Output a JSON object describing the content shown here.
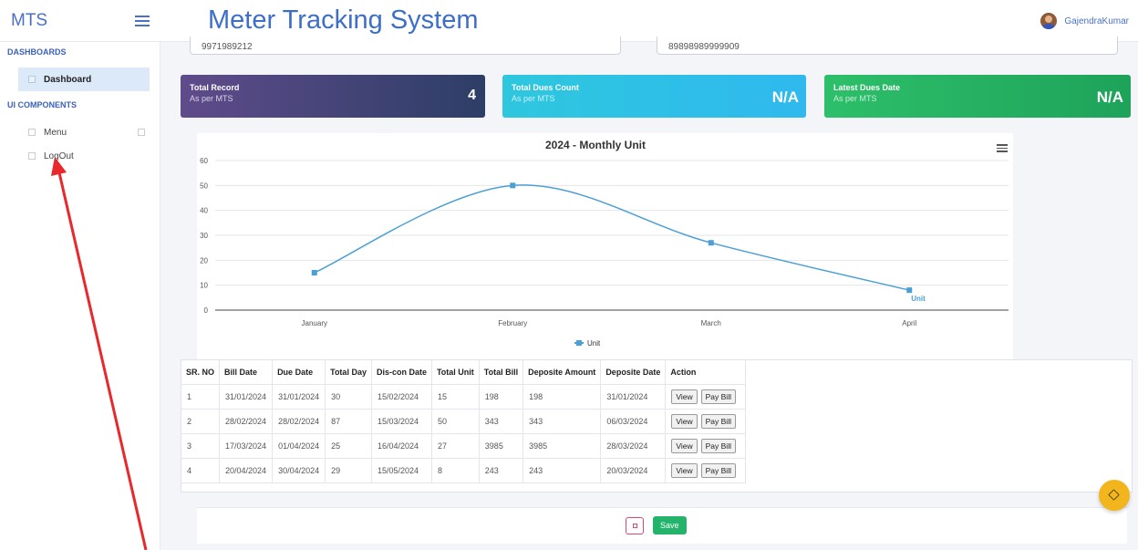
{
  "header": {
    "logo": "MTS",
    "title": "Meter Tracking System",
    "username": "GajendraKumar"
  },
  "sidebar": {
    "section_dashboards": "DASHBOARDS",
    "section_ui": "UI COMPONENTS",
    "items": [
      {
        "label": "Dashboard",
        "active": true
      },
      {
        "label": "Menu"
      },
      {
        "label": "LogOut"
      }
    ]
  },
  "fields": {
    "phone": "9971989212",
    "meter_no": "89898989999909"
  },
  "cards": [
    {
      "title": "Total Record",
      "subtitle": "As per MTS",
      "value": "4",
      "color": "#4a3f73"
    },
    {
      "title": "Total Dues Count",
      "subtitle": "As per MTS",
      "value": "N/A",
      "color": "#2ec7e4"
    },
    {
      "title": "Latest Dues Date",
      "subtitle": "As per MTS",
      "value": "N/A",
      "color": "#26b363"
    }
  ],
  "chart_data": {
    "type": "line",
    "title": "2024 - Monthly Unit",
    "ylabel": "Unit",
    "xlabel": "",
    "categories": [
      "January",
      "February",
      "March",
      "April"
    ],
    "series": [
      {
        "name": "Unit",
        "values": [
          15,
          50,
          27,
          8
        ],
        "color": "#4a9fd6"
      }
    ],
    "ylim": [
      0,
      60
    ],
    "yticks": [
      0,
      10,
      20,
      30,
      40,
      50,
      60
    ],
    "last_point_label": "Unit",
    "legend": "bottom-center",
    "grid": true
  },
  "table": {
    "columns": [
      "SR. NO",
      "Bill Date",
      "Due Date",
      "Total Day",
      "Dis-con Date",
      "Total Unit",
      "Total Bill",
      "Deposite Amount",
      "Deposite Date",
      "Action"
    ],
    "rows": [
      [
        "1",
        "31/01/2024",
        "31/01/2024",
        "30",
        "15/02/2024",
        "15",
        "198",
        "198",
        "31/01/2024"
      ],
      [
        "2",
        "28/02/2024",
        "28/02/2024",
        "87",
        "15/03/2024",
        "50",
        "343",
        "343",
        "06/03/2024"
      ],
      [
        "3",
        "17/03/2024",
        "01/04/2024",
        "25",
        "16/04/2024",
        "27",
        "3985",
        "3985",
        "28/03/2024"
      ],
      [
        "4",
        "20/04/2024",
        "30/04/2024",
        "29",
        "15/05/2024",
        "8",
        "243",
        "243",
        "20/03/2024"
      ]
    ],
    "view_label": "View",
    "pay_label": "Pay Bill"
  },
  "footer": {
    "save_label": "Save"
  }
}
